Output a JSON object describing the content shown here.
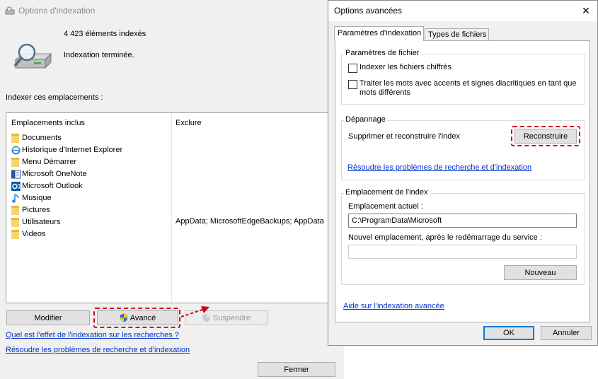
{
  "main_window": {
    "title": "Options d'indexation",
    "indexed_count": "4 423 éléments indexés",
    "status": "Indexation terminée.",
    "locations_label": "Indexer ces emplacements :",
    "columns": {
      "included": "Emplacements inclus",
      "exclude": "Exclure"
    },
    "locations": [
      {
        "name": "Documents",
        "icon": "folder-icon",
        "exclude": ""
      },
      {
        "name": "Historique d'Internet Explorer",
        "icon": "internet-explorer-icon",
        "exclude": ""
      },
      {
        "name": "Menu Démarrer",
        "icon": "folder-icon",
        "exclude": ""
      },
      {
        "name": "Microsoft OneNote",
        "icon": "onenote-icon",
        "exclude": ""
      },
      {
        "name": "Microsoft Outlook",
        "icon": "outlook-icon",
        "exclude": ""
      },
      {
        "name": "Musique",
        "icon": "music-icon",
        "exclude": ""
      },
      {
        "name": "Pictures",
        "icon": "folder-icon",
        "exclude": ""
      },
      {
        "name": "Utilisateurs",
        "icon": "folder-icon",
        "exclude": "AppData; MicrosoftEdgeBackups; AppData"
      },
      {
        "name": "Videos",
        "icon": "folder-icon",
        "exclude": ""
      }
    ],
    "buttons": {
      "modify": "Modifier",
      "advanced": "Avancé",
      "pause": "Suspendre",
      "close": "Fermer"
    },
    "links": {
      "effect": "Quel est l'effet de l'indexation sur les recherches ?",
      "troubleshoot": "Résoudre les problèmes de recherche et d'indexation"
    }
  },
  "dialog": {
    "title": "Options avancées",
    "tabs": [
      {
        "label": "Paramètres d'indexation",
        "active": true
      },
      {
        "label": "Types de fichiers",
        "active": false
      }
    ],
    "file_settings": {
      "label": "Paramètres de fichier",
      "encrypt_label": "Indexer les fichiers chiffrés",
      "encrypt_checked": false,
      "accents_label": "Traiter les mots avec accents et signes diacritiques en tant que mots différents",
      "accents_checked": false
    },
    "troubleshooting": {
      "label": "Dépannage",
      "rebuild_text": "Supprimer et reconstruire l'index",
      "rebuild_button": "Reconstruire",
      "link": "Résoudre les problèmes de recherche et d'indexation"
    },
    "index_location": {
      "label": "Emplacement de l'index",
      "current_label": "Emplacement actuel :",
      "current_value": "C:\\ProgramData\\Microsoft",
      "new_label": "Nouvel emplacement, après le redémarrage du service :",
      "new_value": "",
      "new_button": "Nouveau"
    },
    "help_link": "Aide sur l'indexation avancée",
    "ok": "OK",
    "cancel": "Annuler"
  },
  "colors": {
    "highlight": "#d0021b",
    "link": "#0033cc",
    "selection": "#0078d7"
  }
}
